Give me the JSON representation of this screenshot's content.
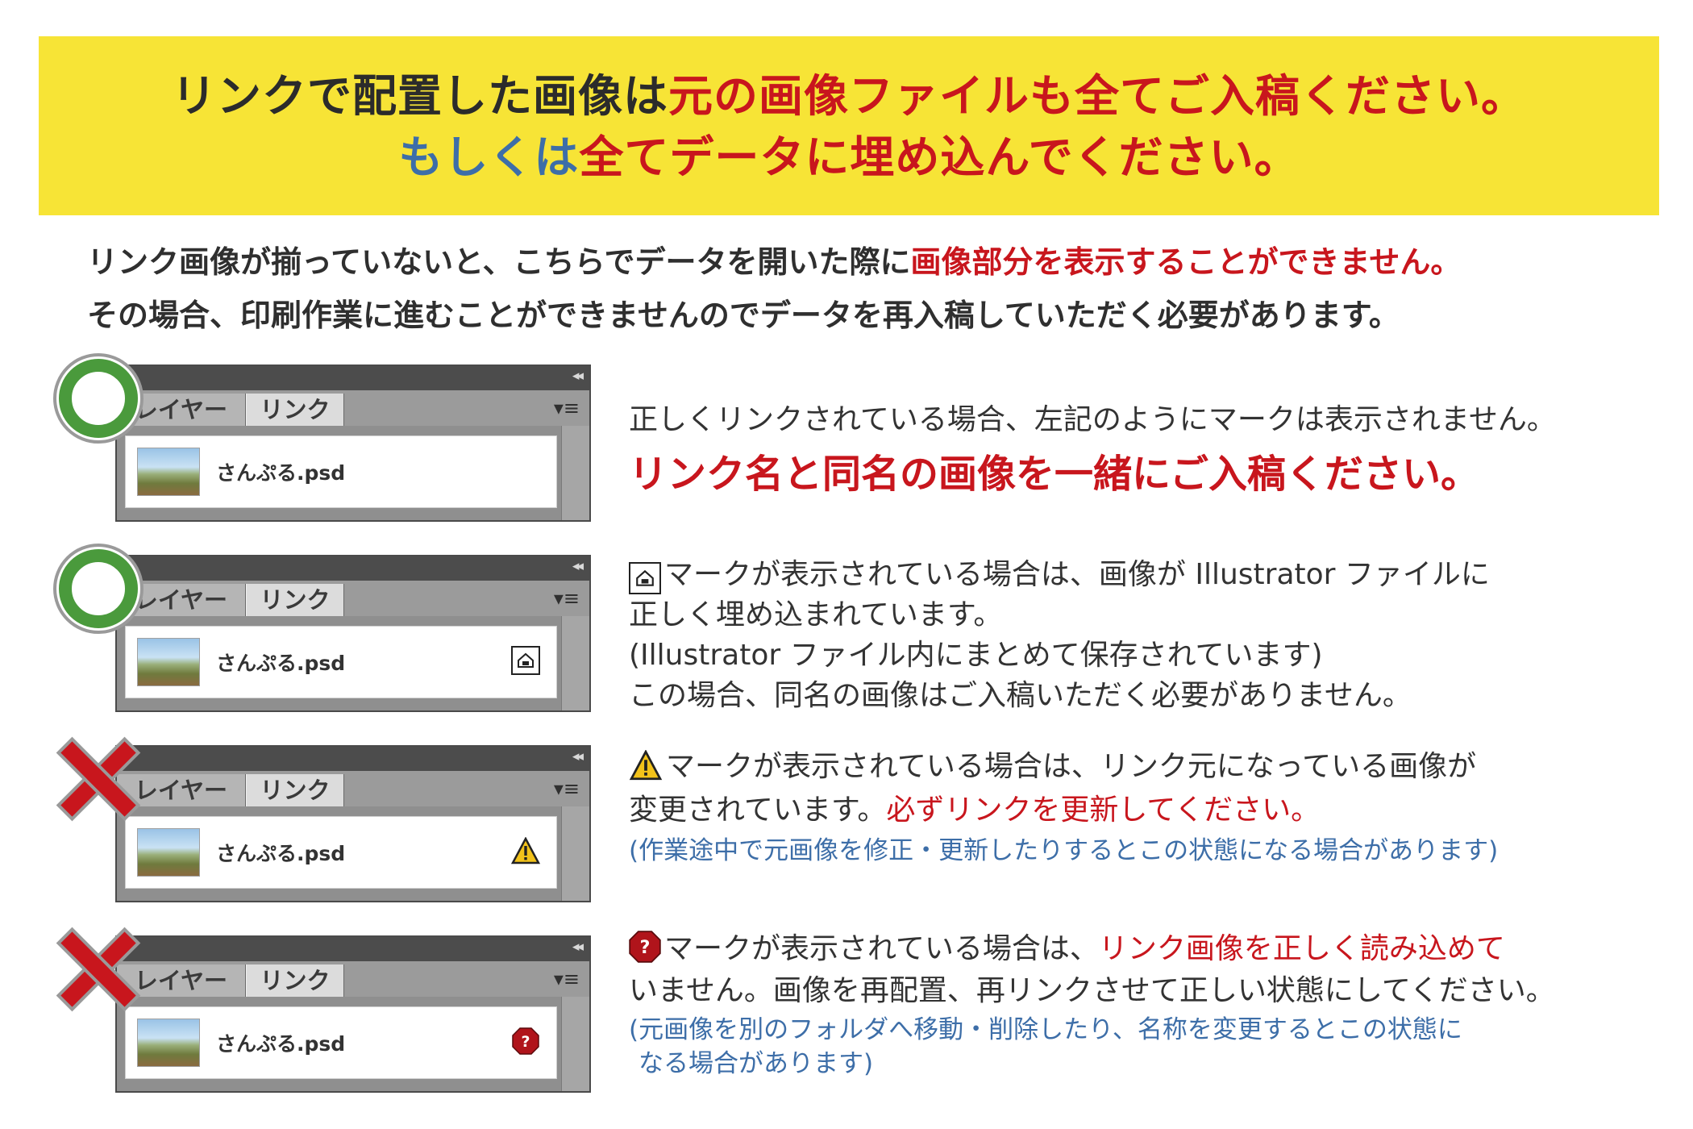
{
  "banner": {
    "line1_black": "リンクで配置した画像は",
    "line1_red": "元の画像ファイルも全てご入稿ください。",
    "line2_blue": "もしくは",
    "line2_red": "全てデータに埋め込んでください。"
  },
  "intro": {
    "line1_black": "リンク画像が揃っていないと、こちらでデータを開いた際に",
    "line1_red": "画像部分を表示することができません。",
    "line2": "その場合、印刷作業に進むことができませんのでデータを再入稿していただく必要があります。"
  },
  "panel_common": {
    "tab_layer": "レイヤー",
    "tab_link": "リンク",
    "filename": "さんぷる.psd",
    "collapse": "◂◂",
    "menu": "▾≡"
  },
  "rows": [
    {
      "mark": "ok-circle",
      "status_icon": "none",
      "text1": "正しくリンクされている場合、左記のようにマークは表示されません。",
      "text2": "リンク名と同名の画像を一緒にご入稿ください。"
    },
    {
      "mark": "ok-circle",
      "status_icon": "embedded-icon",
      "text1": "マークが表示されている場合は、画像が Illustrator ファイルに",
      "text2": "正しく埋め込まれています。",
      "text3": "(Illustrator ファイル内にまとめて保存されています)",
      "text4": "この場合、同名の画像はご入稿いただく必要がありません。"
    },
    {
      "mark": "ng-cross",
      "status_icon": "warning-icon",
      "text1": "マークが表示されている場合は、リンク元になっている画像が",
      "text2_black": "変更されています。",
      "text2_red": "必ずリンクを更新してください。",
      "text3": "(作業途中で元画像を修正・更新したりするとこの状態になる場合があります)"
    },
    {
      "mark": "ng-cross",
      "status_icon": "missing-icon",
      "text1_black": "マークが表示されている場合は、",
      "text1_red": "リンク画像を正しく読み込めて",
      "text2": "いません。画像を再配置、再リンクさせて正しい状態にしてください。",
      "text3": "(元画像を別のフォルダへ移動・削除したり、名称を変更するとこの状態に",
      "text4": "なる場合があります)"
    }
  ],
  "colors": {
    "banner_bg": "#f7e436",
    "red": "#c8161d",
    "blue": "#3d6ea8",
    "ok_green": "#4a9a3c",
    "ng_red": "#c8161d"
  }
}
